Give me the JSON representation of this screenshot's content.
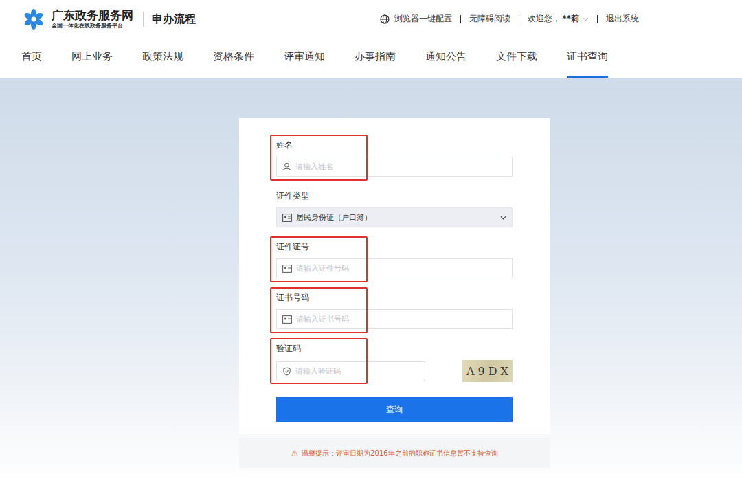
{
  "header": {
    "logo_title": "广东政务服务网",
    "logo_subtitle": "全国一体化在线政务服务平台",
    "section": "申办流程",
    "links": [
      "浏览器一键配置",
      "无障碍阅读"
    ],
    "welcome": "欢迎您，",
    "user": "**莉",
    "logout": "退出系统"
  },
  "nav": [
    {
      "label": "首页",
      "selected": false
    },
    {
      "label": "网上业务",
      "selected": false
    },
    {
      "label": "政策法规",
      "selected": false
    },
    {
      "label": "资格条件",
      "selected": false
    },
    {
      "label": "评审通知",
      "selected": false
    },
    {
      "label": "办事指南",
      "selected": false
    },
    {
      "label": "通知公告",
      "selected": false
    },
    {
      "label": "文件下载",
      "selected": false
    },
    {
      "label": "证书查询",
      "selected": true
    }
  ],
  "form": {
    "fields": [
      {
        "kind": "input",
        "label": "姓名",
        "placeholder": "请输入姓名",
        "highlighted": true
      },
      {
        "kind": "select",
        "label": "证件类型",
        "value": "居民身份证（户口簿）",
        "highlighted": false
      },
      {
        "kind": "input",
        "label": "证件证号",
        "placeholder": "请输入证件号码",
        "highlighted": true
      },
      {
        "kind": "input",
        "label": "证书号码",
        "placeholder": "请输入证书号码",
        "highlighted": true
      },
      {
        "kind": "captcha",
        "label": "验证码",
        "placeholder": "请输入验证码",
        "captcha": "A9DX",
        "highlighted": true
      }
    ],
    "submit": "查询"
  },
  "notice": {
    "icon": "⚠",
    "text": "温馨提示：评审日期为2016年之前的职称证书信息暂不支持查询"
  }
}
